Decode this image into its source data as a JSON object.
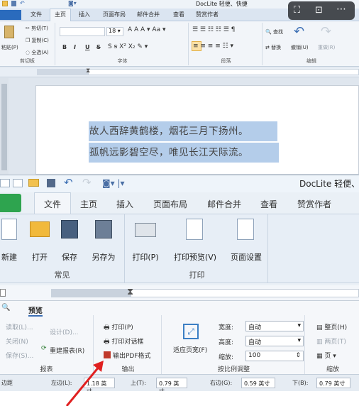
{
  "top_window": {
    "title": "DocLite 轻便、快捷",
    "tabs": [
      "文件",
      "主页",
      "插入",
      "页面布局",
      "邮件合并",
      "查看",
      "赞赏作者"
    ],
    "clipboard": {
      "paste": "粘贴(P)",
      "cut": "剪切(T)",
      "copy": "复制(C)",
      "select_all": "全选(A)",
      "group": "剪切板"
    },
    "font": {
      "size": "18",
      "group": "字体",
      "bold": "B",
      "italic": "I",
      "underline": "U",
      "strike": "S"
    },
    "paragraph": {
      "group": "段落"
    },
    "edit": {
      "find": "查找",
      "replace": "替换",
      "undo": "撤销(U)",
      "redo": "重做(R)",
      "group": "编辑"
    },
    "doc_lines": [
      "故人西辞黄鹤楼，烟花三月下扬州。",
      "孤帆远影碧空尽，唯见长江天际流。"
    ]
  },
  "preview_window": {
    "title": "DocLite 轻便、",
    "file_tab": "文件",
    "tabs": [
      "主页",
      "插入",
      "页面布局",
      "邮件合并",
      "查看",
      "赞赏作者"
    ],
    "common_group": {
      "buttons": [
        "新建",
        "打开",
        "保存",
        "另存为"
      ],
      "label": "常见"
    },
    "print_group": {
      "buttons": [
        "打印(P)",
        "打印预览(V)",
        "页面设置"
      ],
      "label": "打印"
    }
  },
  "preview_ribbon": {
    "tab": "预览",
    "report": {
      "items": [
        "读取(L)...",
        "关闭(N)",
        "保存(S)...",
        "设计(D)...",
        "重建报表(R)"
      ],
      "label": "报表"
    },
    "output": {
      "items": [
        "打印(P)",
        "打印对话框",
        "输出PDF格式"
      ],
      "label": "输出"
    },
    "fit": {
      "button": "适应页宽(F)",
      "width_label": "宽度:",
      "width_value": "自动",
      "height_label": "高度:",
      "height_value": "自动",
      "zoom_label": "缩放:",
      "zoom_value": "100",
      "label": "按比例调整"
    },
    "zoom": {
      "items": [
        "整页(H)",
        "两页(T)",
        "页"
      ],
      "label": "缩放"
    }
  },
  "margins": {
    "left_label": "左边(L):",
    "left_value": "1.18 英寸",
    "top_label": "上(T):",
    "top_value": "0.79 英寸",
    "right_label": "右边(G):",
    "right_value": "0.59 英寸",
    "bottom_label": "下(B):",
    "bottom_value": "0.79 英寸",
    "side_label": "边距"
  },
  "colors": {
    "accent_green": "#2ea44f",
    "selection": "#b4cdea",
    "pdf_icon": "#c0392b",
    "arrow": "#e02020"
  }
}
